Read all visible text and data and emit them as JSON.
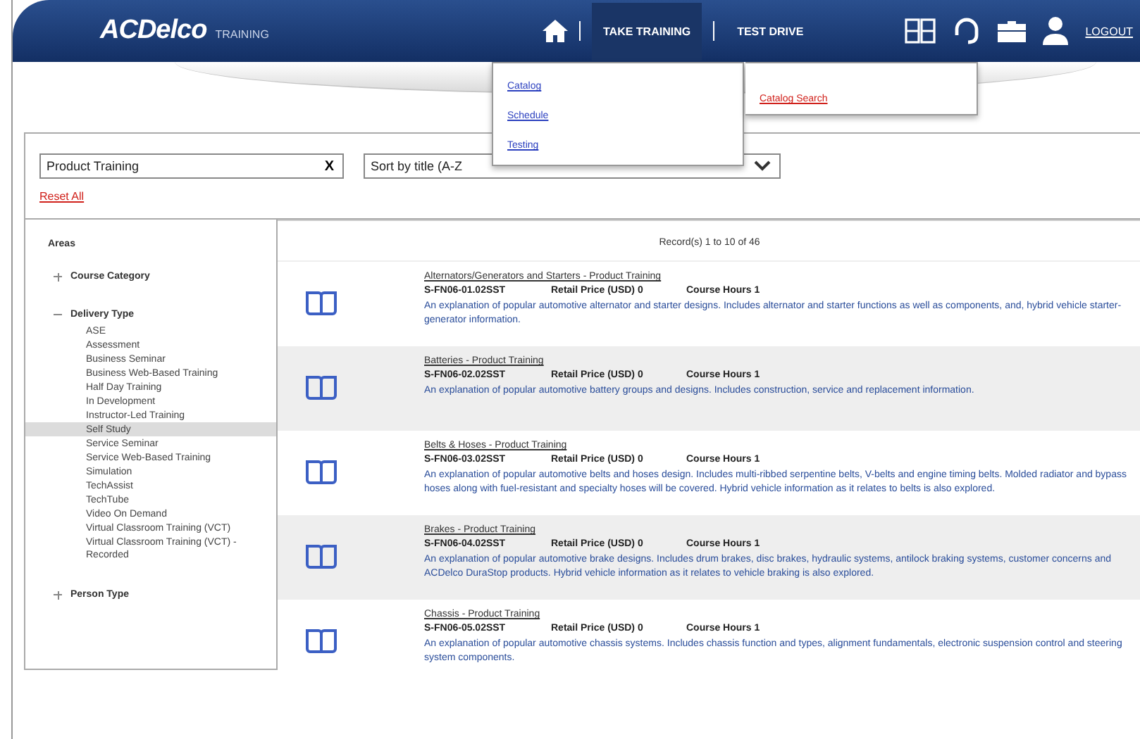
{
  "header": {
    "logo": "ACDelco",
    "logo_sub": "TRAINING",
    "nav": [
      {
        "label": "TAKE TRAINING",
        "selected": true
      },
      {
        "label": "TEST DRIVE",
        "selected": false
      }
    ],
    "logout": "LOGOUT"
  },
  "menu": {
    "items": [
      "Catalog",
      "Schedule",
      "Testing"
    ],
    "side_link": "Catalog Search"
  },
  "filter": {
    "search_value": "Product Training",
    "clear": "X",
    "sort_value": "Sort by title (A-Z",
    "reset": "Reset All"
  },
  "sidebar": {
    "title": "Areas",
    "groups": [
      {
        "label": "Course Category",
        "expanded": false
      },
      {
        "label": "Delivery Type",
        "expanded": true,
        "children": [
          {
            "label": "ASE",
            "selected": false
          },
          {
            "label": "Assessment",
            "selected": false
          },
          {
            "label": "Business Seminar",
            "selected": false
          },
          {
            "label": "Business Web-Based Training",
            "selected": false
          },
          {
            "label": "Half Day Training",
            "selected": false
          },
          {
            "label": "In Development",
            "selected": false
          },
          {
            "label": "Instructor-Led Training",
            "selected": false
          },
          {
            "label": "Self Study",
            "selected": true
          },
          {
            "label": "Service Seminar",
            "selected": false
          },
          {
            "label": "Service Web-Based Training",
            "selected": false
          },
          {
            "label": "Simulation",
            "selected": false
          },
          {
            "label": "TechAssist",
            "selected": false
          },
          {
            "label": "TechTube",
            "selected": false
          },
          {
            "label": "Video On Demand",
            "selected": false
          },
          {
            "label": "Virtual Classroom Training (VCT)",
            "selected": false
          },
          {
            "label": "Virtual Classroom Training (VCT) - Recorded",
            "selected": false
          }
        ]
      },
      {
        "label": "Person Type",
        "expanded": false
      }
    ]
  },
  "results": {
    "summary": "Record(s) 1 to 10 of 46",
    "rows": [
      {
        "title": "Alternators/Generators and Starters - Product Training",
        "code": "S-FN06-01.02SST",
        "price": "Retail Price (USD) 0",
        "hours": "Course Hours 1",
        "description": "An explanation of popular automotive alternator and starter designs. Includes alternator and starter functions as well as components, and, hybrid vehicle starter-generator information."
      },
      {
        "title": "Batteries - Product Training",
        "code": "S-FN06-02.02SST",
        "price": "Retail Price (USD) 0",
        "hours": "Course Hours 1",
        "description": "An explanation of popular automotive battery groups and designs. Includes construction, service and replacement information."
      },
      {
        "title": "Belts & Hoses - Product Training",
        "code": "S-FN06-03.02SST",
        "price": "Retail Price (USD) 0",
        "hours": "Course Hours 1",
        "description": "An explanation of popular automotive belts and hoses design. Includes multi-ribbed serpentine belts, V-belts and engine timing belts. Molded radiator and bypass hoses along with fuel-resistant and specialty hoses will be covered. Hybrid vehicle information as it relates to belts is also explored."
      },
      {
        "title": "Brakes - Product Training",
        "code": "S-FN06-04.02SST",
        "price": "Retail Price (USD) 0",
        "hours": "Course Hours 1",
        "description": "An explanation of popular automotive brake designs. Includes drum brakes, disc brakes, hydraulic systems, antilock braking systems, customer concerns and ACDelco DuraStop products. Hybrid vehicle information as it relates to vehicle braking is also explored."
      },
      {
        "title": "Chassis - Product Training",
        "code": "S-FN06-05.02SST",
        "price": "Retail Price (USD) 0",
        "hours": "Course Hours 1",
        "description": "An explanation of popular automotive chassis systems. Includes chassis function and types, alignment fundamentals, electronic suspension control and steering system components."
      }
    ]
  }
}
